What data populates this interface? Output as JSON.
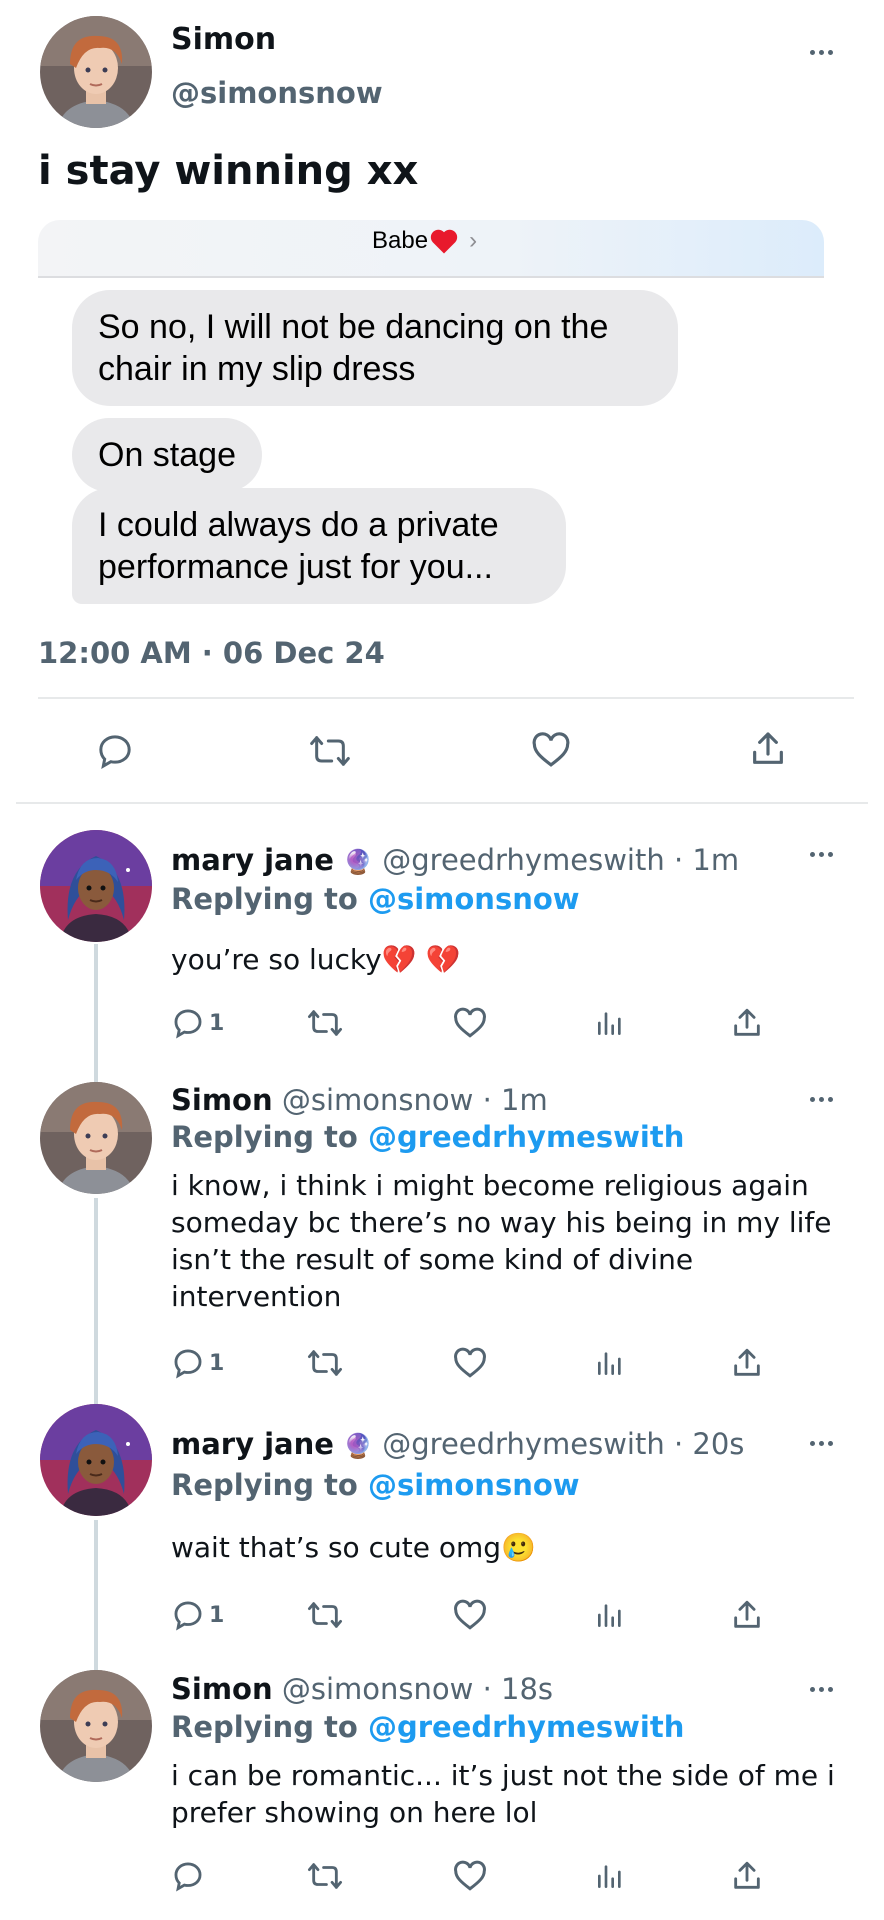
{
  "main_tweet": {
    "name": "Simon",
    "handle": "@simonsnow",
    "text": "i stay winning xx",
    "timestamp": "12:00 AM · 06 Dec 24",
    "embedded": {
      "contact_name": "Babe",
      "contact_emoji": "❤️",
      "messages": [
        "So no, I will not be dancing on the chair in my slip dress",
        "On stage",
        "I could always do a private performance just for you..."
      ]
    }
  },
  "replies": [
    {
      "name": "mary jane",
      "emoji": "🔮",
      "handle": "@greedrhymeswith",
      "time": "· 1m",
      "replying_prefix": "Replying to",
      "replying_to": "@simonsnow",
      "text": "you’re so lucky💔 💔",
      "reply_count": "1"
    },
    {
      "name": "Simon",
      "handle": "@simonsnow",
      "time": "· 1m",
      "replying_prefix": "Replying to",
      "replying_to": "@greedrhymeswith",
      "text": "i know, i think i might become religious again someday bc there’s no way his being in my life isn’t the result of some kind of divine intervention",
      "reply_count": "1"
    },
    {
      "name": "mary jane",
      "emoji": "🔮",
      "handle": "@greedrhymeswith",
      "time": "· 20s",
      "replying_prefix": "Replying to",
      "replying_to": "@simonsnow",
      "text": "wait that’s so cute omg🥲",
      "reply_count": "1"
    },
    {
      "name": "Simon",
      "handle": "@simonsnow",
      "time": "· 18s",
      "replying_prefix": "Replying to",
      "replying_to": "@greedrhymeswith",
      "text": "i can be romantic... it’s just not the side of me i prefer showing on here lol",
      "reply_count": ""
    }
  ],
  "icons": [
    "more-icon",
    "reply-icon",
    "retweet-icon",
    "like-icon",
    "views-icon",
    "share-icon"
  ],
  "colors": {
    "accent": "#1d9bf0",
    "muted": "#536471",
    "bubble": "#e9e9eb",
    "heart": "#e0245e"
  }
}
